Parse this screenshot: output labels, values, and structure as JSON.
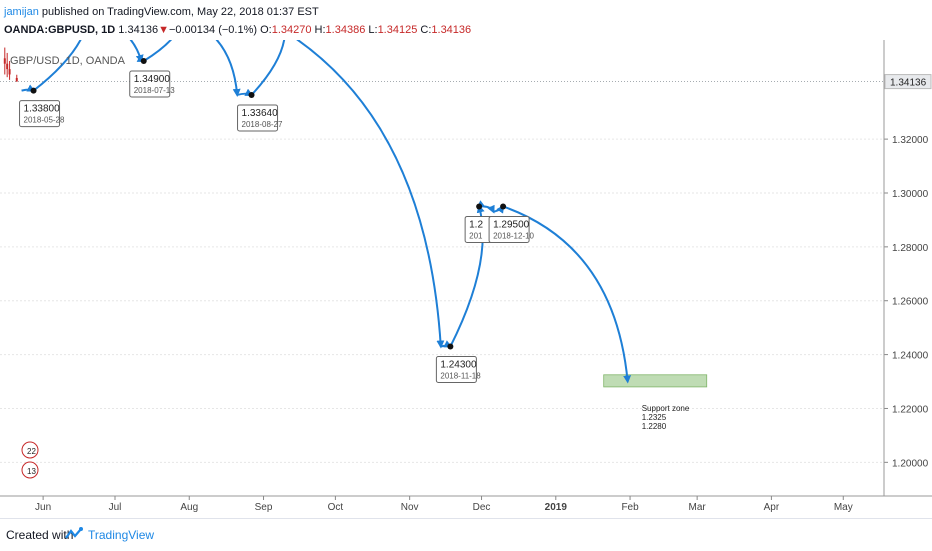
{
  "header": {
    "author": "jamijan",
    "published_text": "published on TradingView.com, May 22, 2018 01:37 EST",
    "symbol": "OANDA:GBPUSD, 1D",
    "last": "1.34136",
    "arrow": "▼",
    "change": "−0.00134 (−0.1%)",
    "o_label": "O:",
    "o_value": "1.34270",
    "h_label": "H:",
    "h_value": "1.34386",
    "l_label": "L:",
    "l_value": "1.34125",
    "c_label": "C:",
    "c_value": "1.34136"
  },
  "footer": {
    "created_with": "Created with",
    "brand": "TradingView"
  },
  "colors": {
    "arrow": "#1e7fd6",
    "down": "#c62828",
    "zone_fill": "#b5d7a8",
    "zone_stroke": "#6aa84f",
    "price_tag": "#e8eaed"
  },
  "chart_data": {
    "type": "line",
    "title": "GBP/USD, 1D, OANDA",
    "xlabel": "",
    "ylabel": "",
    "x_ticks": [
      "Jun",
      "Jul",
      "Aug",
      "Sep",
      "Oct",
      "Nov",
      "Dec",
      "2019",
      "Feb",
      "Mar",
      "Apr",
      "May"
    ],
    "x_tick_dates": [
      "2018-06-01",
      "2018-07-01",
      "2018-08-01",
      "2018-09-01",
      "2018-10-01",
      "2018-11-01",
      "2018-12-01",
      "2019-01-01",
      "2019-02-01",
      "2019-03-01",
      "2019-04-01",
      "2019-05-01"
    ],
    "xlim": [
      "2018-05-14",
      "2019-05-18"
    ],
    "y_ticks": [
      "1.32000",
      "1.30000",
      "1.28000",
      "1.26000",
      "1.24000",
      "1.22000",
      "1.20000"
    ],
    "y_tick_values": [
      1.32,
      1.3,
      1.28,
      1.26,
      1.24,
      1.22,
      1.2
    ],
    "ylim": [
      1.1875,
      1.3568
    ],
    "current_price": 1.34136,
    "current_price_label": "1.34136",
    "grid": "horizontal",
    "projection_path": [
      {
        "x": "2018-05-23",
        "y": 1.338
      },
      {
        "x": "2018-05-28",
        "y": 1.338
      },
      {
        "x": "2018-06-20",
        "y": 1.365
      },
      {
        "x": "2018-07-12",
        "y": 1.349
      },
      {
        "x": "2018-07-13",
        "y": 1.349
      },
      {
        "x": "2018-07-30",
        "y": 1.365
      },
      {
        "x": "2018-08-21",
        "y": 1.3364
      },
      {
        "x": "2018-08-27",
        "y": 1.3364
      },
      {
        "x": "2018-09-10",
        "y": 1.36
      },
      {
        "x": "2018-11-14",
        "y": 1.243
      },
      {
        "x": "2018-11-18",
        "y": 1.243
      },
      {
        "x": "2018-11-30",
        "y": 1.295
      },
      {
        "x": "2018-12-02",
        "y": 1.295
      },
      {
        "x": "2018-12-06",
        "y": 1.293
      },
      {
        "x": "2018-12-10",
        "y": 1.295
      },
      {
        "x": "2019-01-31",
        "y": 1.23
      }
    ],
    "labels": [
      {
        "price": "1.33800",
        "date": "2018-05-28",
        "x": "2018-05-28",
        "y": 1.338
      },
      {
        "price": "1.34900",
        "date": "2018-07-13",
        "x": "2018-07-13",
        "y": 1.349
      },
      {
        "price": "1.33640",
        "date": "2018-08-27",
        "x": "2018-08-27",
        "y": 1.3364
      },
      {
        "price": "1.24300",
        "date": "2018-11-18",
        "x": "2018-11-18",
        "y": 1.243
      },
      {
        "price": "1.2",
        "date": "201",
        "x": "2018-11-30",
        "y": 1.295
      },
      {
        "price": "1.29500",
        "date": "2018-12-10",
        "x": "2018-12-10",
        "y": 1.295
      }
    ],
    "support_zone": {
      "x_start": "2019-01-21",
      "x_end": "2019-03-05",
      "y_top": 1.2325,
      "y_bottom": 1.228
    },
    "support_zone_text": [
      "Support zone",
      "1.2325",
      "1.2280"
    ],
    "recent_candles": [
      {
        "date": "2018-05-16",
        "open": 1.35,
        "high": 1.354,
        "low": 1.344,
        "close": 1.348
      },
      {
        "date": "2018-05-17",
        "open": 1.348,
        "high": 1.352,
        "low": 1.343,
        "close": 1.346
      },
      {
        "date": "2018-05-18",
        "open": 1.346,
        "high": 1.349,
        "low": 1.342,
        "close": 1.344
      },
      {
        "date": "2018-05-21",
        "open": 1.3427,
        "high": 1.3439,
        "low": 1.3413,
        "close": 1.3414
      }
    ],
    "event_badges": [
      "22",
      "13"
    ]
  }
}
